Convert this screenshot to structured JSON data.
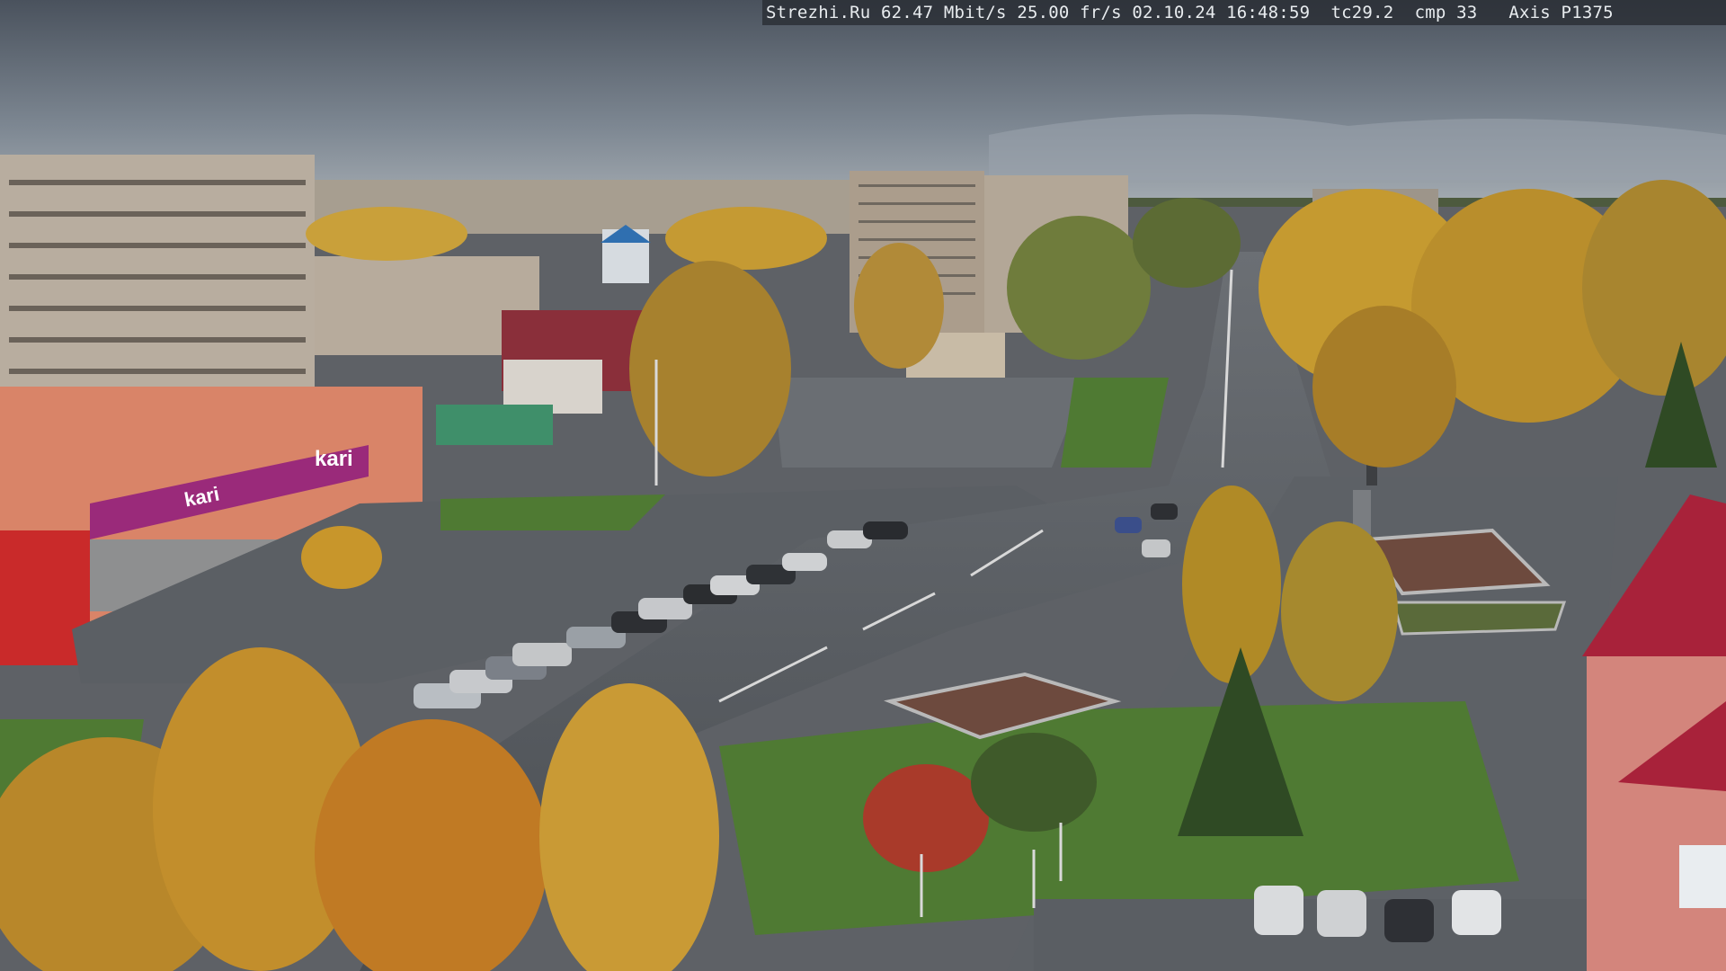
{
  "overlay": {
    "text": "Strezhi.Ru 62.47 Mbit/s 25.00 fr/s 02.10.24 16:48:59  tc29.2  cmp 33   Axis P1375"
  },
  "signs": {
    "kari_roof": "kari",
    "kari_wall": "kari"
  },
  "colors": {
    "sky": "#6b7480",
    "road": "#55595e",
    "grass": "#4f7a33",
    "foliage": "#c89a28",
    "building_brick": "#b9a892",
    "mall_facade": "#d9826b",
    "kari_magenta": "#9a2a7a"
  }
}
